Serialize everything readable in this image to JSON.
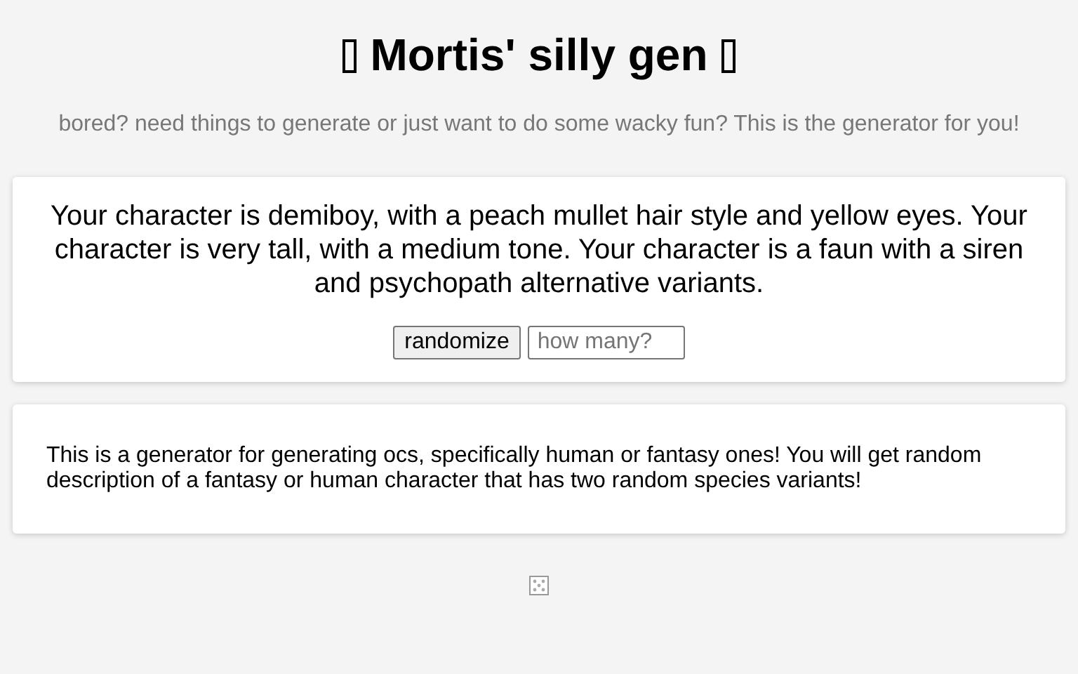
{
  "title": "Mortis' silly gen",
  "subtitle": "bored? need things to generate or just want to do some wacky fun? This is the generator for you!",
  "result": "Your character is demiboy, with a peach mullet hair style and yellow eyes. Your character is very tall, with a medium tone. Your character is a faun with a siren and psychopath alternative variants.",
  "button": "randomize",
  "count_field": {
    "placeholder": "how many?"
  },
  "description": "This is a generator for generating ocs, specifically human or fantasy ones! You will get random description of a fantasy or human character that has two random species variants!"
}
